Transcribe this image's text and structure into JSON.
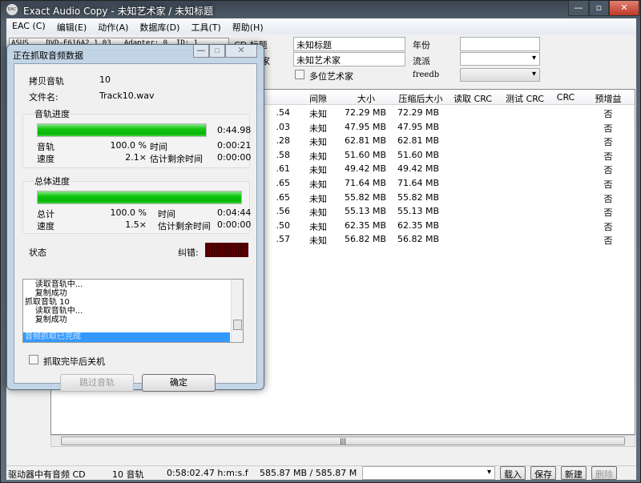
{
  "window": {
    "title": "Exact Audio Copy  -  未知艺术家 / 未知标题",
    "icon": "EAC"
  },
  "menu": [
    "EAC (C)",
    "编辑(E)",
    "动作(A)",
    "数据库(D)",
    "工具(T)",
    "帮助(H)"
  ],
  "drive": "ASUS    DVD-E616A2 1.03   Adapter: 0  ID: 1",
  "cd": {
    "title_label": "CD 标题",
    "title_value": "未知标题",
    "artist_label": "家",
    "artist_value": "未知艺术家",
    "year_label": "年份",
    "year_value": "",
    "genre_label": "流派",
    "genre_value": "",
    "multi_artist_label": "多位艺术家",
    "freedb_label": "freedb",
    "freedb_value": ""
  },
  "table": {
    "headers": [
      "间隙",
      "大小",
      "压缩后大小",
      "读取 CRC",
      "测试 CRC",
      "CRC",
      "预增益"
    ],
    "rows": [
      [
        ".54",
        "未知",
        "72.29 MB",
        "72.29 MB",
        "",
        "",
        "",
        "否"
      ],
      [
        ".03",
        "未知",
        "47.95 MB",
        "47.95 MB",
        "",
        "",
        "",
        "否"
      ],
      [
        ".28",
        "未知",
        "62.81 MB",
        "62.81 MB",
        "",
        "",
        "",
        "否"
      ],
      [
        ".58",
        "未知",
        "51.60 MB",
        "51.60 MB",
        "",
        "",
        "",
        "否"
      ],
      [
        ".61",
        "未知",
        "49.42 MB",
        "49.42 MB",
        "",
        "",
        "",
        "否"
      ],
      [
        ".65",
        "未知",
        "71.64 MB",
        "71.64 MB",
        "",
        "",
        "",
        "否"
      ],
      [
        ".65",
        "未知",
        "55.82 MB",
        "55.82 MB",
        "",
        "",
        "",
        "否"
      ],
      [
        ".56",
        "未知",
        "55.13 MB",
        "55.13 MB",
        "",
        "",
        "",
        "否"
      ],
      [
        ".50",
        "未知",
        "62.35 MB",
        "62.35 MB",
        "",
        "",
        "",
        "否"
      ],
      [
        ".57",
        "未知",
        "56.82 MB",
        "56.82 MB",
        "",
        "",
        "",
        "否"
      ]
    ]
  },
  "status": {
    "cd_state": "驱动器中有音频 CD",
    "tracks": "10 音轨",
    "length": "0:58:02.47 h:m:s.f",
    "size": "585.87 MB / 585.87 M",
    "load": "载入",
    "save": "保存",
    "new": "新建",
    "delete": "删除"
  },
  "dialog": {
    "title": "正在抓取音频数据",
    "copy_track_label": "拷贝音轨",
    "copy_track_value": "10",
    "filename_label": "文件名:",
    "filename_value": "Track10.wav",
    "track_group": "音轨进度",
    "track_progress": 100,
    "track_length": "0:44.98",
    "track_label": "音轨",
    "track_pct": "100.0 %",
    "time_label": "时间",
    "track_time": "0:00:21",
    "speed_label": "速度",
    "track_speed": "2.1×",
    "remain_label": "估计剩余时间",
    "track_remain": "0:00:00",
    "total_group": "总体进度",
    "total_progress": 100,
    "total_label": "总计",
    "total_pct": "100.0 %",
    "total_time": "0:04:44",
    "total_speed": "1.5×",
    "total_remain": "0:00:00",
    "state_label": "状态",
    "error_label": "纠错:",
    "log": [
      "    读取音轨中...",
      "    复制成功",
      "抓取音轨 10",
      "    读取音轨中...",
      "    复制成功"
    ],
    "log_selected": "音频抓取已完成",
    "shutdown_label": "抓取完毕后关机",
    "skip_button": "跳过音轨",
    "ok_button": "确定"
  }
}
